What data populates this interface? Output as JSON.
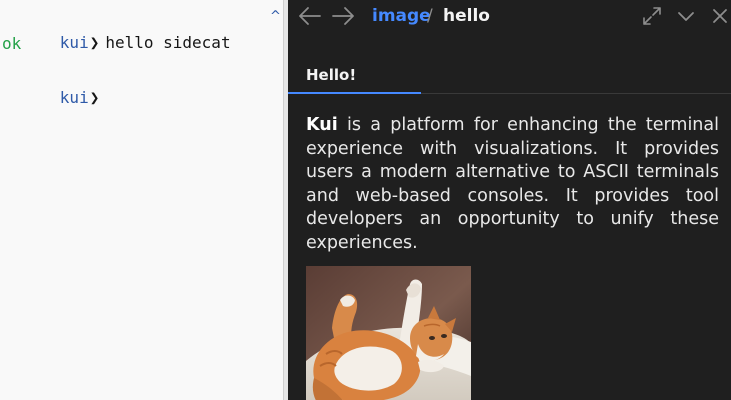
{
  "terminal": {
    "prompt_label": "kui",
    "prompt_chevron": "❯",
    "command": "hello sidecat",
    "output": "ok",
    "collapse_glyph": "^"
  },
  "sidecar": {
    "breadcrumb": {
      "kind": "image",
      "separator": "/",
      "name": "hello"
    },
    "nav": {
      "back_icon": "arrow-left-icon",
      "forward_icon": "arrow-right-icon"
    },
    "window_controls": {
      "maximize_icon": "maximize-icon",
      "minimize_icon": "chevron-down-icon",
      "close_icon": "close-icon"
    },
    "tabs": [
      {
        "label": "Hello!",
        "active": true
      }
    ],
    "body": {
      "brand": "Kui",
      "text": " is a platform for enhancing the terminal experience with visualizations. It provides users a modern alternative to ASCII terminals and web-based consoles. It provides tool developers an opportunity to unify these experiences."
    },
    "image_subject": "orange-and-white cat lying on its back on a white blanket"
  },
  "colors": {
    "terminal_bg": "#f9f9f9",
    "prompt_blue": "#2f5aa8",
    "output_green": "#24a148",
    "sidecar_bg": "#1f1f1f",
    "accent_blue": "#4589ff",
    "sidecar_text": "#f4f4f4",
    "icon_gray": "#8d8d8d"
  }
}
